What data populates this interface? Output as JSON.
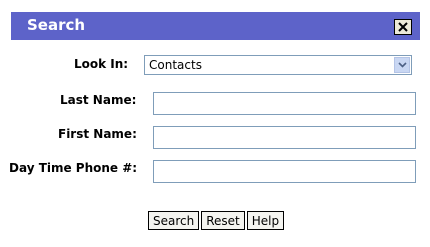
{
  "dialog": {
    "title": "Search",
    "close_icon": "close-x-icon"
  },
  "form": {
    "look_in_label": "Look In:",
    "look_in_value": "Contacts",
    "last_name_label": "Last Name:",
    "first_name_label": "First Name:",
    "phone_label": "Day Time Phone #:",
    "last_name_value": "",
    "first_name_value": "",
    "phone_value": ""
  },
  "buttons": {
    "search": "Search",
    "reset": "Reset",
    "help": "Help"
  },
  "colors": {
    "title_bar": "#5d63c9",
    "input_border": "#7f9db9"
  }
}
